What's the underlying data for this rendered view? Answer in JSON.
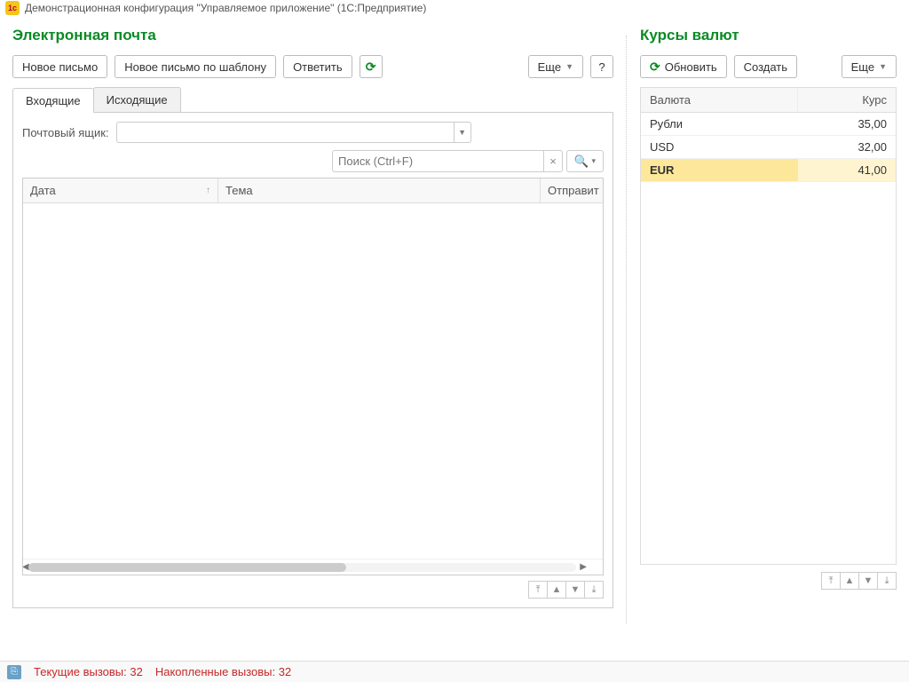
{
  "titlebar": {
    "title": "Демонстрационная конфигурация \"Управляемое приложение\"  (1С:Предприятие)"
  },
  "email": {
    "heading": "Электронная почта",
    "toolbar": {
      "new_message": "Новое письмо",
      "new_from_template": "Новое письмо по шаблону",
      "reply": "Ответить",
      "more": "Еще",
      "help": "?"
    },
    "tabs": {
      "inbox": "Входящие",
      "outbox": "Исходящие"
    },
    "mailbox_label": "Почтовый ящик:",
    "mailbox_value": "",
    "search_placeholder": "Поиск (Ctrl+F)",
    "columns": {
      "date": "Дата",
      "subject": "Тема",
      "sender": "Отправит"
    }
  },
  "rates": {
    "heading": "Курсы валют",
    "toolbar": {
      "refresh": "Обновить",
      "create": "Создать",
      "more": "Еще"
    },
    "columns": {
      "currency": "Валюта",
      "rate": "Курс"
    },
    "rows": [
      {
        "currency": "Рубли",
        "rate": "35,00",
        "selected": false
      },
      {
        "currency": "USD",
        "rate": "32,00",
        "selected": false
      },
      {
        "currency": "EUR",
        "rate": "41,00",
        "selected": true
      }
    ]
  },
  "status": {
    "current_calls_label": "Текущие вызовы:",
    "current_calls_value": "32",
    "accumulated_calls_label": "Накопленные вызовы:",
    "accumulated_calls_value": "32"
  }
}
